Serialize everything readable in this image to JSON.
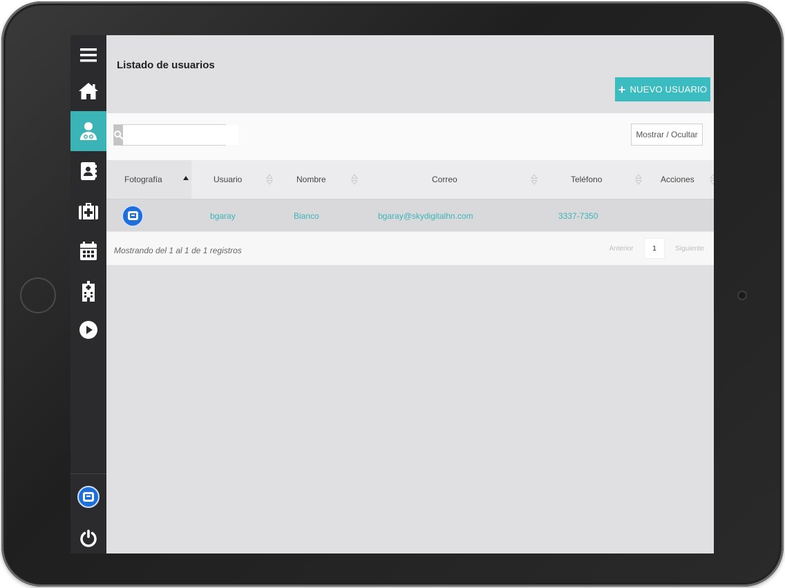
{
  "sidebar": {
    "items": [
      {
        "icon": "menu-icon"
      },
      {
        "icon": "home-icon"
      },
      {
        "icon": "doctor-user-icon",
        "active": true
      },
      {
        "icon": "contact-book-icon"
      },
      {
        "icon": "medical-kit-icon"
      },
      {
        "icon": "calendar-icon"
      },
      {
        "icon": "building-icon"
      },
      {
        "icon": "play-icon"
      }
    ],
    "bottom": [
      {
        "icon": "app-logo-icon"
      },
      {
        "icon": "power-icon"
      }
    ]
  },
  "header": {
    "title": "Listado de usuarios",
    "new_button_label": "NUEVO USUARIO"
  },
  "toolbar": {
    "search_placeholder": "",
    "search_value": "",
    "toggle_columns_label": "Mostrar / Ocultar"
  },
  "table": {
    "columns": [
      "Fotografía",
      "Usuario",
      "Nombre",
      "Correo",
      "Teléfono",
      "Acciones"
    ],
    "rows": [
      {
        "photo": "app-logo-icon",
        "usuario": "bgaray",
        "nombre": "Bianco",
        "correo": "bgaray@skydigitalhn.com",
        "telefono": "3337-7350",
        "acciones": ""
      }
    ]
  },
  "footer": {
    "info": "Mostrando del 1 al 1 de 1 registros",
    "prev_label": "Anterior",
    "current_page": "1",
    "next_label": "Siguiente"
  },
  "colors": {
    "accent": "#3bb4b8",
    "sidebar_bg": "#2b2b2d",
    "logo_blue": "#1e6fd9"
  }
}
